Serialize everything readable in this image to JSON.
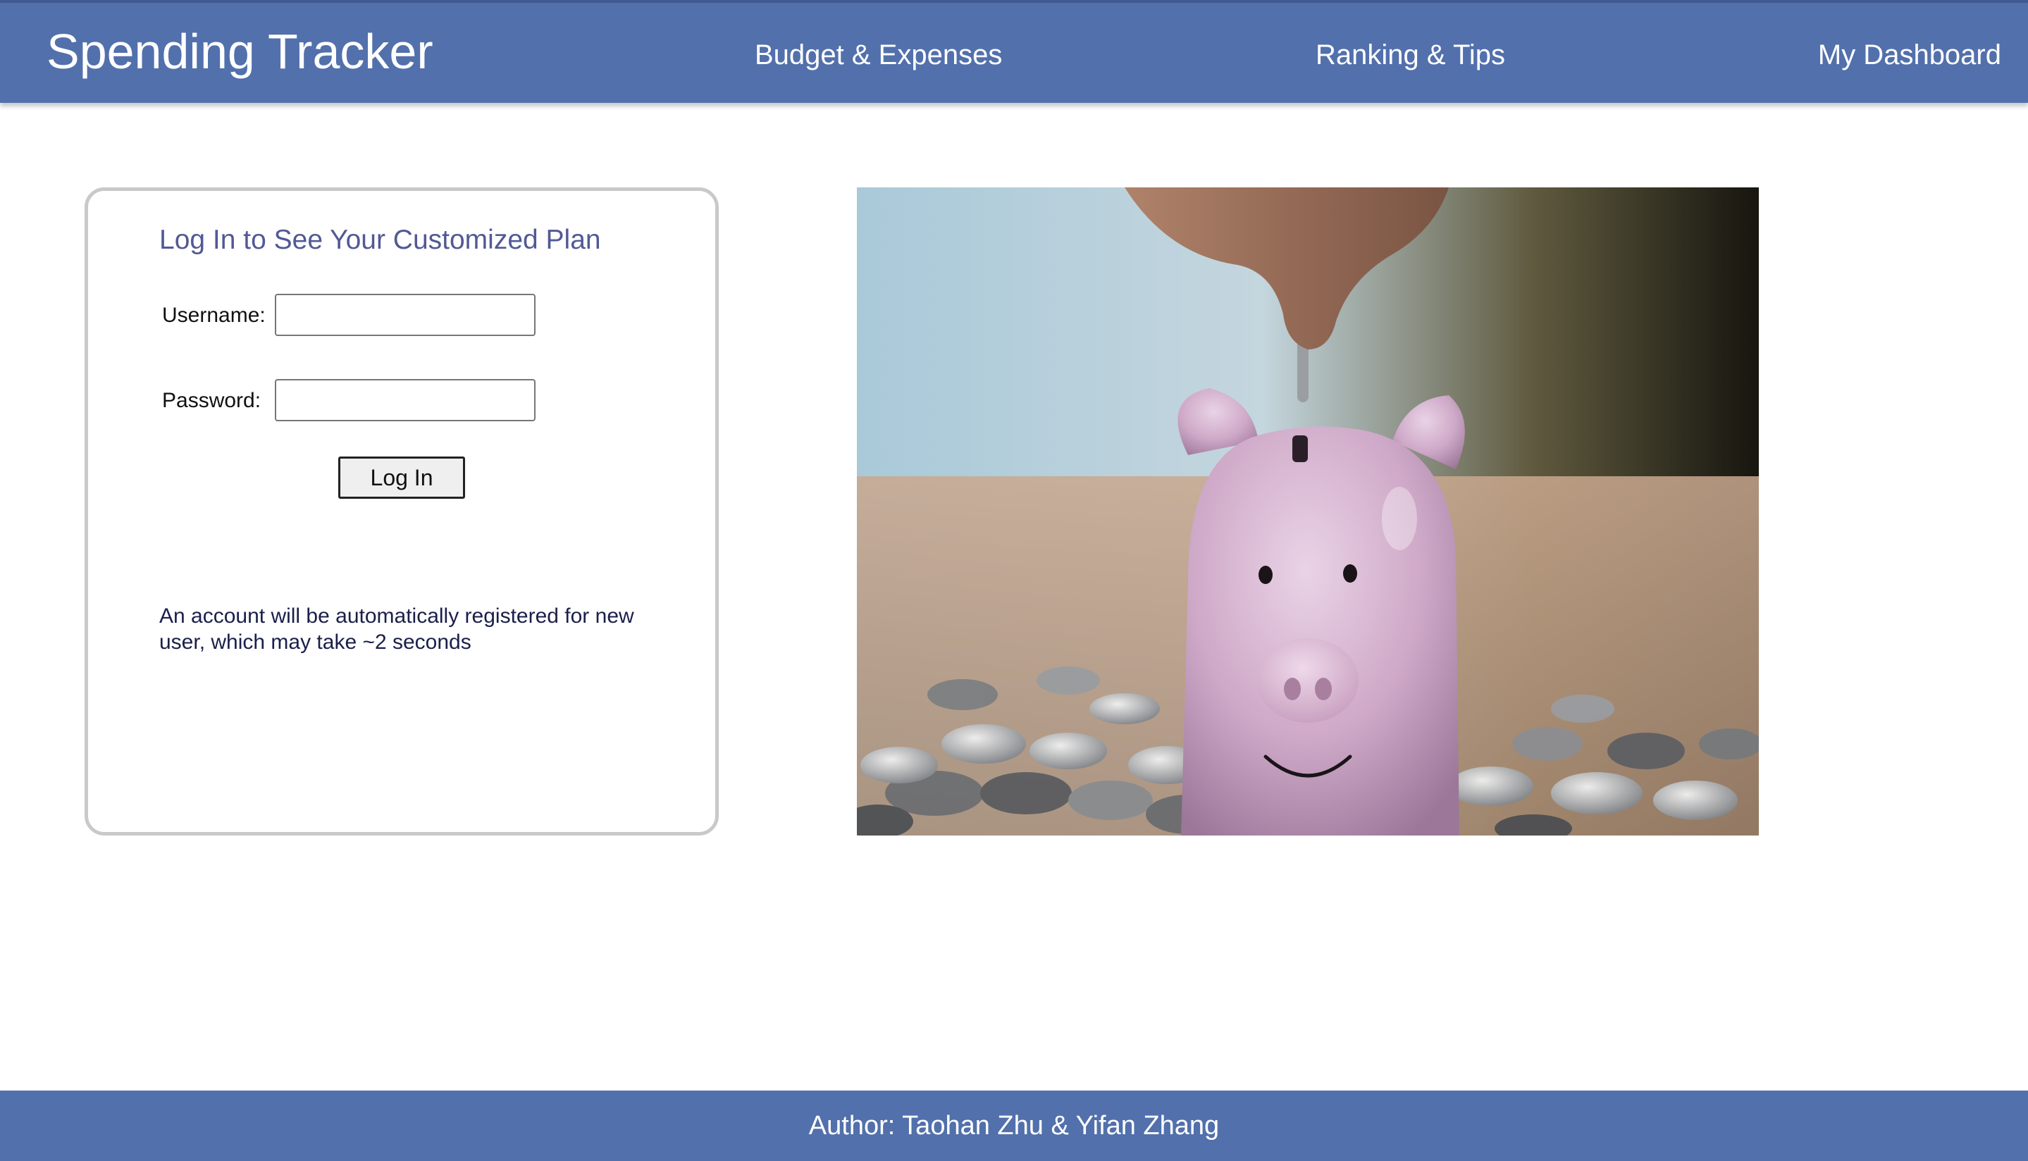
{
  "header": {
    "brand": "Spending Tracker",
    "nav": [
      {
        "label": "Budget & Expenses"
      },
      {
        "label": "Ranking & Tips"
      },
      {
        "label": "My Dashboard"
      }
    ]
  },
  "login": {
    "title": "Log In to See Your Customized Plan",
    "username_label": "Username:",
    "username_value": "",
    "password_label": "Password:",
    "password_value": "",
    "button_label": "Log In",
    "note": "An account will be automatically registered for new user, which may take ~2 seconds"
  },
  "hero": {
    "subject": "piggy-bank-with-coins-photo"
  },
  "footer": {
    "text": "Author: Taohan Zhu & Yifan Zhang"
  },
  "colors": {
    "brand_bar": "#5270ac",
    "title_text": "#525994",
    "note_text": "#1a1f4a",
    "card_border": "#c9c9c9"
  }
}
